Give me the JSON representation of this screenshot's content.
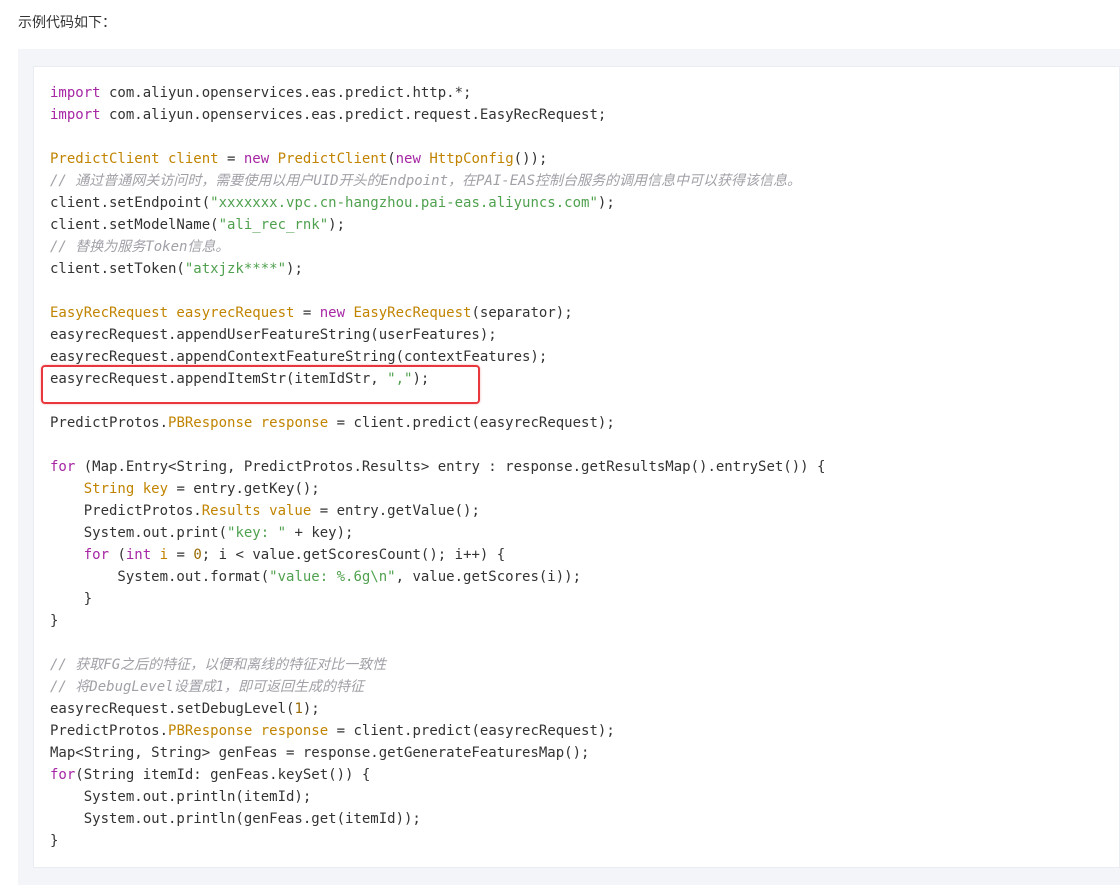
{
  "intro_text": "示例代码如下：",
  "colors": {
    "keyword": "#a626a4",
    "type": "#c18401",
    "string": "#50a14f",
    "number": "#986801",
    "comment": "#a0a1a7",
    "highlight_border": "#e8383d"
  },
  "code_lines": [
    [
      {
        "t": "kw",
        "v": "import"
      },
      {
        "t": "pl",
        "v": " com.aliyun.openservices.eas.predict.http.*;"
      }
    ],
    [
      {
        "t": "kw",
        "v": "import"
      },
      {
        "t": "pl",
        "v": " com.aliyun.openservices.eas.predict.request.EasyRecRequest;"
      }
    ],
    [],
    [
      {
        "t": "ty",
        "v": "PredictClient client"
      },
      {
        "t": "pl",
        "v": " = "
      },
      {
        "t": "kw",
        "v": "new"
      },
      {
        "t": "pl",
        "v": " "
      },
      {
        "t": "ty",
        "v": "PredictClient"
      },
      {
        "t": "pl",
        "v": "("
      },
      {
        "t": "kw",
        "v": "new"
      },
      {
        "t": "pl",
        "v": " "
      },
      {
        "t": "ty",
        "v": "HttpConfig"
      },
      {
        "t": "pl",
        "v": "());"
      }
    ],
    [
      {
        "t": "cmt",
        "v": "// 通过普通网关访问时，需要使用以用户UID开头的Endpoint，在PAI-EAS控制台服务的调用信息中可以获得该信息。"
      }
    ],
    [
      {
        "t": "pl",
        "v": "client.setEndpoint("
      },
      {
        "t": "str",
        "v": "\"xxxxxxx.vpc.cn-hangzhou.pai-eas.aliyuncs.com\""
      },
      {
        "t": "pl",
        "v": ");"
      }
    ],
    [
      {
        "t": "pl",
        "v": "client.setModelName("
      },
      {
        "t": "str",
        "v": "\"ali_rec_rnk\""
      },
      {
        "t": "pl",
        "v": ");"
      }
    ],
    [
      {
        "t": "cmt",
        "v": "// 替换为服务Token信息。"
      }
    ],
    [
      {
        "t": "pl",
        "v": "client.setToken("
      },
      {
        "t": "str",
        "v": "\"atxjzk****\""
      },
      {
        "t": "pl",
        "v": ");"
      }
    ],
    [],
    [
      {
        "t": "ty",
        "v": "EasyRecRequest easyrecRequest"
      },
      {
        "t": "pl",
        "v": " = "
      },
      {
        "t": "kw",
        "v": "new"
      },
      {
        "t": "pl",
        "v": " "
      },
      {
        "t": "ty",
        "v": "EasyRecRequest"
      },
      {
        "t": "pl",
        "v": "(separator);"
      }
    ],
    [
      {
        "t": "pl",
        "v": "easyrecRequest.appendUserFeatureString(userFeatures);"
      }
    ],
    [
      {
        "t": "pl",
        "v": "easyrecRequest.appendContextFeatureString(contextFeatures);"
      }
    ],
    [
      {
        "t": "pl",
        "v": "easyrecRequest.appendItemStr(itemIdStr, "
      },
      {
        "t": "str",
        "v": "\",\""
      },
      {
        "t": "pl",
        "v": ");"
      }
    ],
    [],
    [
      {
        "t": "pl",
        "v": "PredictProtos."
      },
      {
        "t": "ty",
        "v": "PBResponse response"
      },
      {
        "t": "pl",
        "v": " = client.predict(easyrecRequest);"
      }
    ],
    [],
    [
      {
        "t": "kw",
        "v": "for"
      },
      {
        "t": "pl",
        "v": " (Map.Entry<String, PredictProtos.Results> entry : response.getResultsMap().entrySet()) {"
      }
    ],
    [
      {
        "t": "pl",
        "v": "    "
      },
      {
        "t": "ty",
        "v": "String key"
      },
      {
        "t": "pl",
        "v": " = entry.getKey();"
      }
    ],
    [
      {
        "t": "pl",
        "v": "    PredictProtos."
      },
      {
        "t": "ty",
        "v": "Results value"
      },
      {
        "t": "pl",
        "v": " = entry.getValue();"
      }
    ],
    [
      {
        "t": "pl",
        "v": "    System.out.print("
      },
      {
        "t": "str",
        "v": "\"key: \""
      },
      {
        "t": "pl",
        "v": " + key);"
      }
    ],
    [
      {
        "t": "pl",
        "v": "    "
      },
      {
        "t": "kw",
        "v": "for"
      },
      {
        "t": "pl",
        "v": " ("
      },
      {
        "t": "kw",
        "v": "int"
      },
      {
        "t": "pl",
        "v": " "
      },
      {
        "t": "ty",
        "v": "i"
      },
      {
        "t": "pl",
        "v": " = "
      },
      {
        "t": "num",
        "v": "0"
      },
      {
        "t": "pl",
        "v": "; i < value.getScoresCount(); i++) {"
      }
    ],
    [
      {
        "t": "pl",
        "v": "        System.out.format("
      },
      {
        "t": "str",
        "v": "\"value: %.6g\\n\""
      },
      {
        "t": "pl",
        "v": ", value.getScores(i));"
      }
    ],
    [
      {
        "t": "pl",
        "v": "    }"
      }
    ],
    [
      {
        "t": "pl",
        "v": "}"
      }
    ],
    [],
    [
      {
        "t": "cmt",
        "v": "// 获取FG之后的特征，以便和离线的特征对比一致性"
      }
    ],
    [
      {
        "t": "cmt",
        "v": "// 将DebugLevel设置成1，即可返回生成的特征"
      }
    ],
    [
      {
        "t": "pl",
        "v": "easyrecRequest.setDebugLevel("
      },
      {
        "t": "num",
        "v": "1"
      },
      {
        "t": "pl",
        "v": ");"
      }
    ],
    [
      {
        "t": "pl",
        "v": "PredictProtos."
      },
      {
        "t": "ty",
        "v": "PBResponse response"
      },
      {
        "t": "pl",
        "v": " = client.predict(easyrecRequest);"
      }
    ],
    [
      {
        "t": "pl",
        "v": "Map<String, String> genFeas = response.getGenerateFeaturesMap();"
      }
    ],
    [
      {
        "t": "kw",
        "v": "for"
      },
      {
        "t": "pl",
        "v": "(String itemId: genFeas.keySet()) {"
      }
    ],
    [
      {
        "t": "pl",
        "v": "    System.out.println(itemId);"
      }
    ],
    [
      {
        "t": "pl",
        "v": "    System.out.println(genFeas.get(itemId));"
      }
    ],
    [
      {
        "t": "pl",
        "v": "}"
      }
    ]
  ]
}
